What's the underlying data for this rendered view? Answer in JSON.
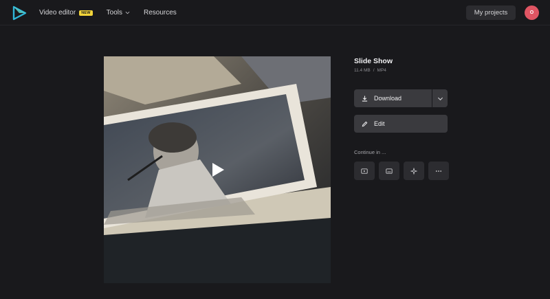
{
  "header": {
    "logo_icon": "play-triangle-logo-icon",
    "nav": [
      {
        "label": "Video editor",
        "badge": "NEW"
      },
      {
        "label": "Tools",
        "has_dropdown": true
      },
      {
        "label": "Resources"
      }
    ],
    "my_projects_label": "My projects",
    "avatar_initial": "O"
  },
  "preview": {
    "play_icon": "play-icon"
  },
  "file": {
    "name": "Slide Show",
    "size": "11.4 MB",
    "separator": "/",
    "format": "MP4"
  },
  "actions": {
    "download_label": "Download",
    "download_icon": "download-icon",
    "more_icon": "chevron-down-icon",
    "edit_label": "Edit",
    "edit_icon": "pencil-icon"
  },
  "continue": {
    "label": "Continue in ...",
    "options": [
      {
        "icon": "video-player-icon"
      },
      {
        "icon": "subtitles-icon"
      },
      {
        "icon": "sparkle-icon"
      },
      {
        "icon": "more-dots-icon"
      }
    ]
  },
  "colors": {
    "background": "#19191c",
    "button": "#3a3a3e",
    "badge": "#f2d43a",
    "avatar": "#e05563",
    "logo_accent": "#2fb6d8"
  }
}
